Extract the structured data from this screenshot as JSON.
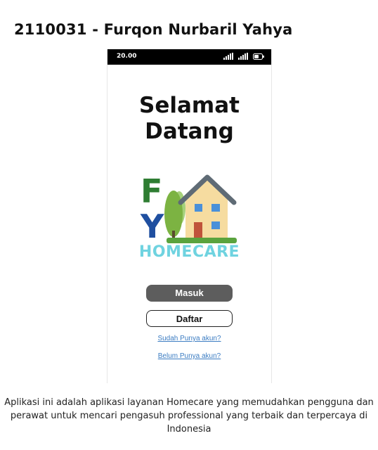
{
  "page": {
    "heading": "2110031 - Furqon Nurbaril Yahya",
    "caption_lines": [
      "Aplikasi ini adalah  aplikasi layanan Homecare yang memudahkan pengguna dan",
      "perawat untuk mencari pengasuh professional yang terbaik dan terpercaya di",
      "Indonesia"
    ]
  },
  "status_bar": {
    "time": "20.00",
    "icons": [
      "signal-icon",
      "signal-icon",
      "battery-icon"
    ]
  },
  "welcome": {
    "line1": "Selamat",
    "line2": "Datang"
  },
  "logo": {
    "letters": [
      "F",
      "Y"
    ],
    "brand": "HOMECARE",
    "colors": {
      "F": "#2e7d32",
      "Y": "#1f4fa0",
      "brand": "#6fd3e0",
      "roof": "#5f6b75",
      "walls": "#f6dca0",
      "windows": "#4a90d9",
      "door": "#c0533a",
      "tree": "#7cb342",
      "grass": "#5aa33d"
    }
  },
  "buttons": {
    "login": "Masuk",
    "register": "Daftar"
  },
  "links": {
    "has_account": "Sudah Punya akun?",
    "no_account": "Belum Punya akun?"
  }
}
